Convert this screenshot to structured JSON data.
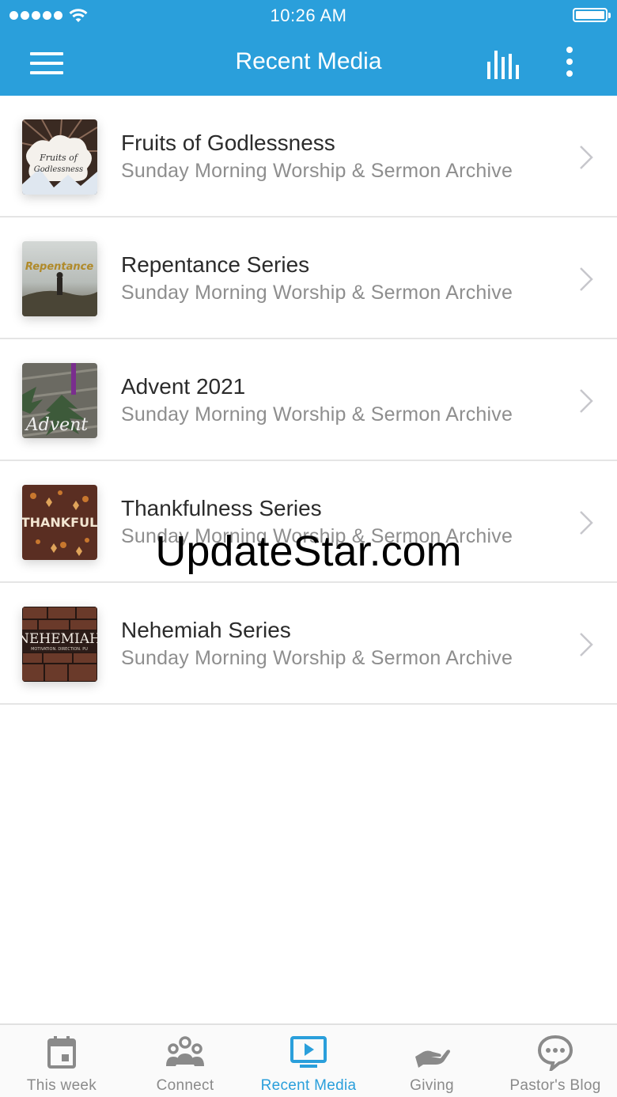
{
  "status_bar": {
    "time": "10:26 AM"
  },
  "nav": {
    "title": "Recent Media"
  },
  "items": [
    {
      "title": "Fruits of Godlessness",
      "subtitle": "Sunday Morning Worship & Sermon Archive",
      "thumb_text": "Fruits of Godlessness"
    },
    {
      "title": "Repentance Series",
      "subtitle": "Sunday Morning Worship & Sermon Archive",
      "thumb_text": "Repentance"
    },
    {
      "title": "Advent 2021",
      "subtitle": "Sunday Morning Worship & Sermon Archive",
      "thumb_text": "Advent"
    },
    {
      "title": "Thankfulness Series",
      "subtitle": "Sunday Morning Worship & Sermon Archive",
      "thumb_text": "THANKFUL"
    },
    {
      "title": "Nehemiah Series",
      "subtitle": "Sunday Morning Worship & Sermon Archive",
      "thumb_text": "NEHEMIAH",
      "thumb_subtext": "MOTIVATION. DIRECTION. PU"
    }
  ],
  "watermark": "UpdateStar.com",
  "tabs": [
    {
      "label": "This week",
      "icon": "calendar-icon",
      "active": false
    },
    {
      "label": "Connect",
      "icon": "people-icon",
      "active": false
    },
    {
      "label": "Recent Media",
      "icon": "play-screen-icon",
      "active": true
    },
    {
      "label": "Giving",
      "icon": "giving-hand-icon",
      "active": false
    },
    {
      "label": "Pastor's Blog",
      "icon": "chat-bubble-icon",
      "active": false
    }
  ],
  "colors": {
    "accent": "#2a9fdb",
    "tab_inactive": "#8a8a8a",
    "subtitle": "#8e8e8e"
  }
}
